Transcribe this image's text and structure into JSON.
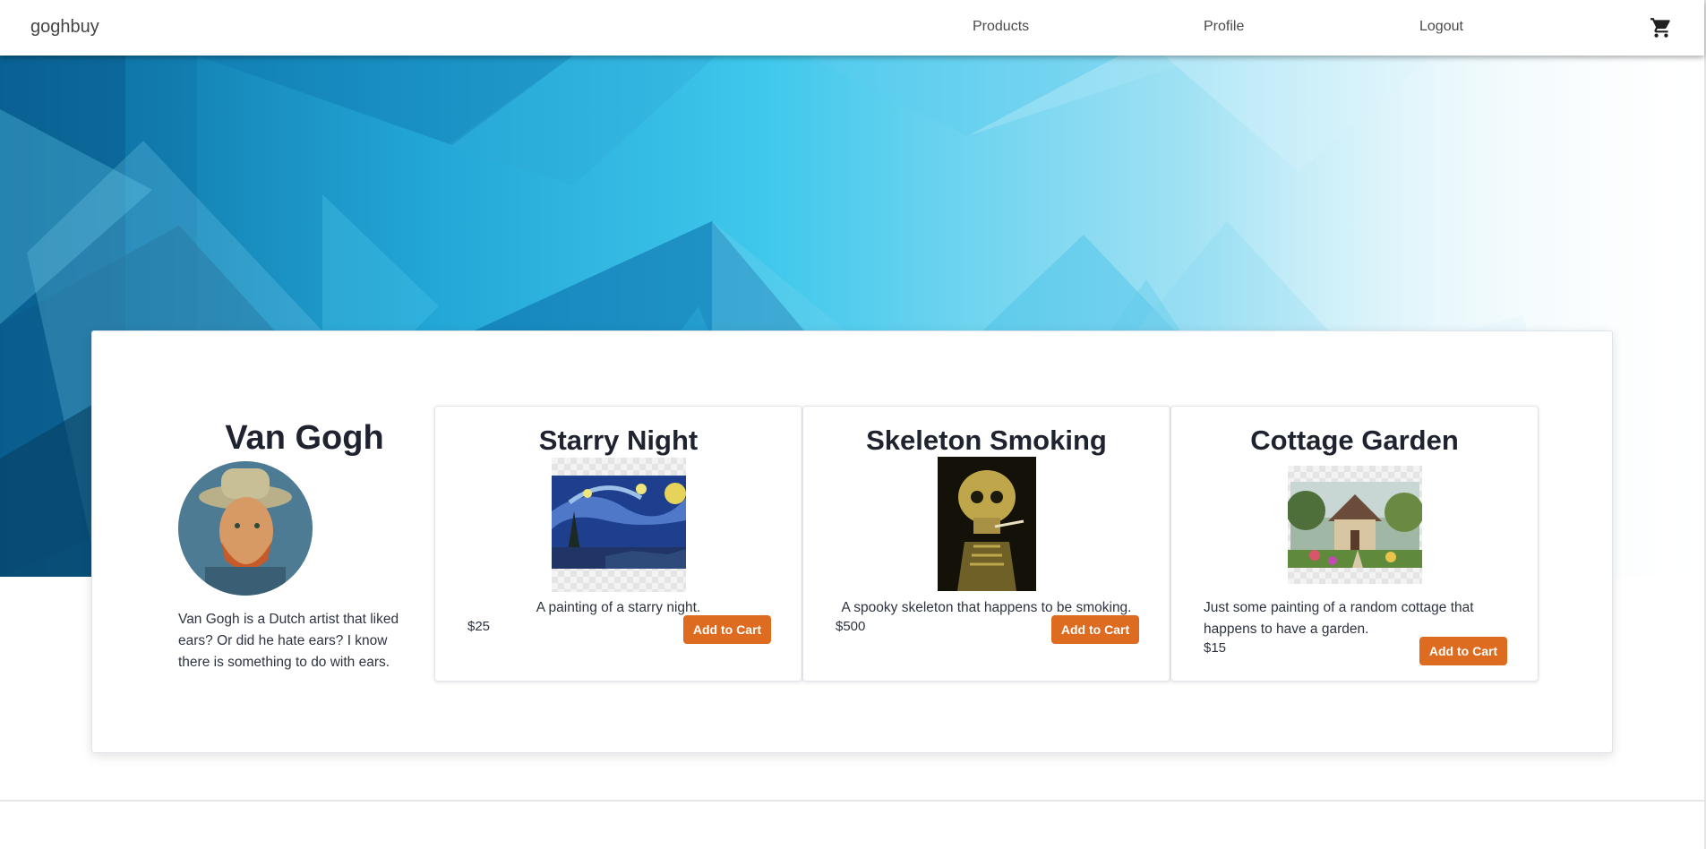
{
  "nav": {
    "brand": "goghbuy",
    "links": [
      "Products",
      "Profile",
      "Logout"
    ],
    "cart_icon": "shopping-cart-icon"
  },
  "artist": {
    "name": "Van Gogh",
    "bio": "Van Gogh is a Dutch artist that liked ears? Or did he hate ears? I know there is something to do with ears."
  },
  "products": [
    {
      "title": "Starry Night",
      "description": "A painting of a starry night.",
      "price": "$25",
      "button": "Add to Cart"
    },
    {
      "title": "Skeleton Smoking",
      "description": "A spooky skeleton that happens to be smoking.",
      "price": "$500",
      "button": "Add to Cart"
    },
    {
      "title": "Cottage Garden",
      "description": "Just some painting of a random cottage that happens to have a garden.",
      "price": "$15",
      "button": "Add to Cart"
    }
  ],
  "colors": {
    "accent": "#dd6b20",
    "hero_dark": "#0a5a8c",
    "hero_mid": "#3fc7ea",
    "hero_light": "#d8f3fb"
  }
}
